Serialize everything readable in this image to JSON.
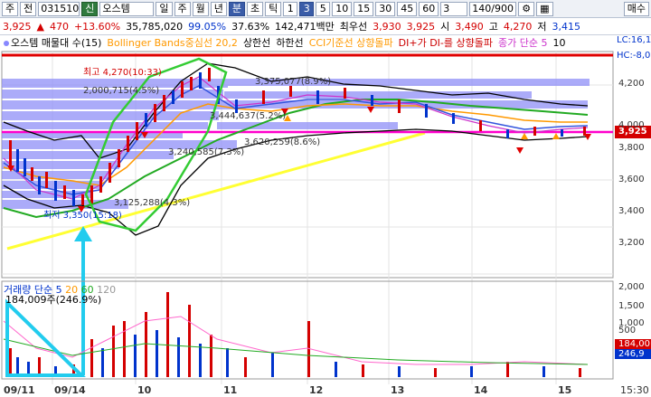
{
  "toolbar": {
    "items": [
      "주",
      "전",
      "031510",
      "신",
      "오스템",
      "일",
      "주",
      "월",
      "년",
      "분",
      "초",
      "틱",
      "1",
      "3",
      "5",
      "10",
      "15",
      "30",
      "45",
      "60",
      "3",
      "140/900",
      "매수"
    ]
  },
  "quote": {
    "price": "3,925",
    "change": "470",
    "change_pct": "+13.60%",
    "volume": "35,785,020",
    "vol_pct1": "99.05%",
    "vol_pct2": "37.63%",
    "amount": "142,471백만",
    "best_label": "최우선",
    "best_ask": "3,930",
    "best_bid": "3,925",
    "open_label": "시",
    "open": "3,490",
    "high_label": "고",
    "high": "4,270",
    "low_label": "저",
    "low": "3,415"
  },
  "legend": {
    "items": [
      "오스템 매물대 수(15)",
      "Bollinger Bands중심선 20,2",
      "상한선",
      "하한선",
      "CCI기준선 상향돌파",
      "DI+가 DI-를 상향돌파",
      "종가 단순 5",
      "10"
    ],
    "right_lc": "LC:16,1",
    "right_hc": "HC:-8,0"
  },
  "price_axis": [
    "4,200",
    "4,000",
    "3,925",
    "3,800",
    "3,600",
    "3,400",
    "3,200"
  ],
  "vol_axis": [
    "2,000",
    "1,500",
    "1,000",
    "500",
    "184,00",
    "246,9"
  ],
  "annotations": {
    "high": "최고 4,270(10:33)",
    "low": "최저 3,350(15:18)",
    "a1": "2,000,715(4.5%)",
    "a2": "3,375,077(8.9%)",
    "a3": "3,444,637(5.2%)",
    "a4": "3,240,585(7.3%)",
    "a5": "3,620,259(8.6%)",
    "a6": "3,125,288(4.3%)"
  },
  "volume_legend": {
    "title": "거래량 단순 5",
    "ma20": "20",
    "ma60": "60",
    "ma120": "120",
    "value": "184,009주(246.9%)"
  },
  "x_labels": [
    "09/11",
    "09/14",
    "10",
    "11",
    "12",
    "13",
    "14",
    "15"
  ],
  "time_right": "15:30",
  "colors": {
    "up": "#d40000",
    "down": "#0033cc",
    "highlight": "#33cc33",
    "arrow": "#22ccee",
    "trend": "#ffff33"
  }
}
